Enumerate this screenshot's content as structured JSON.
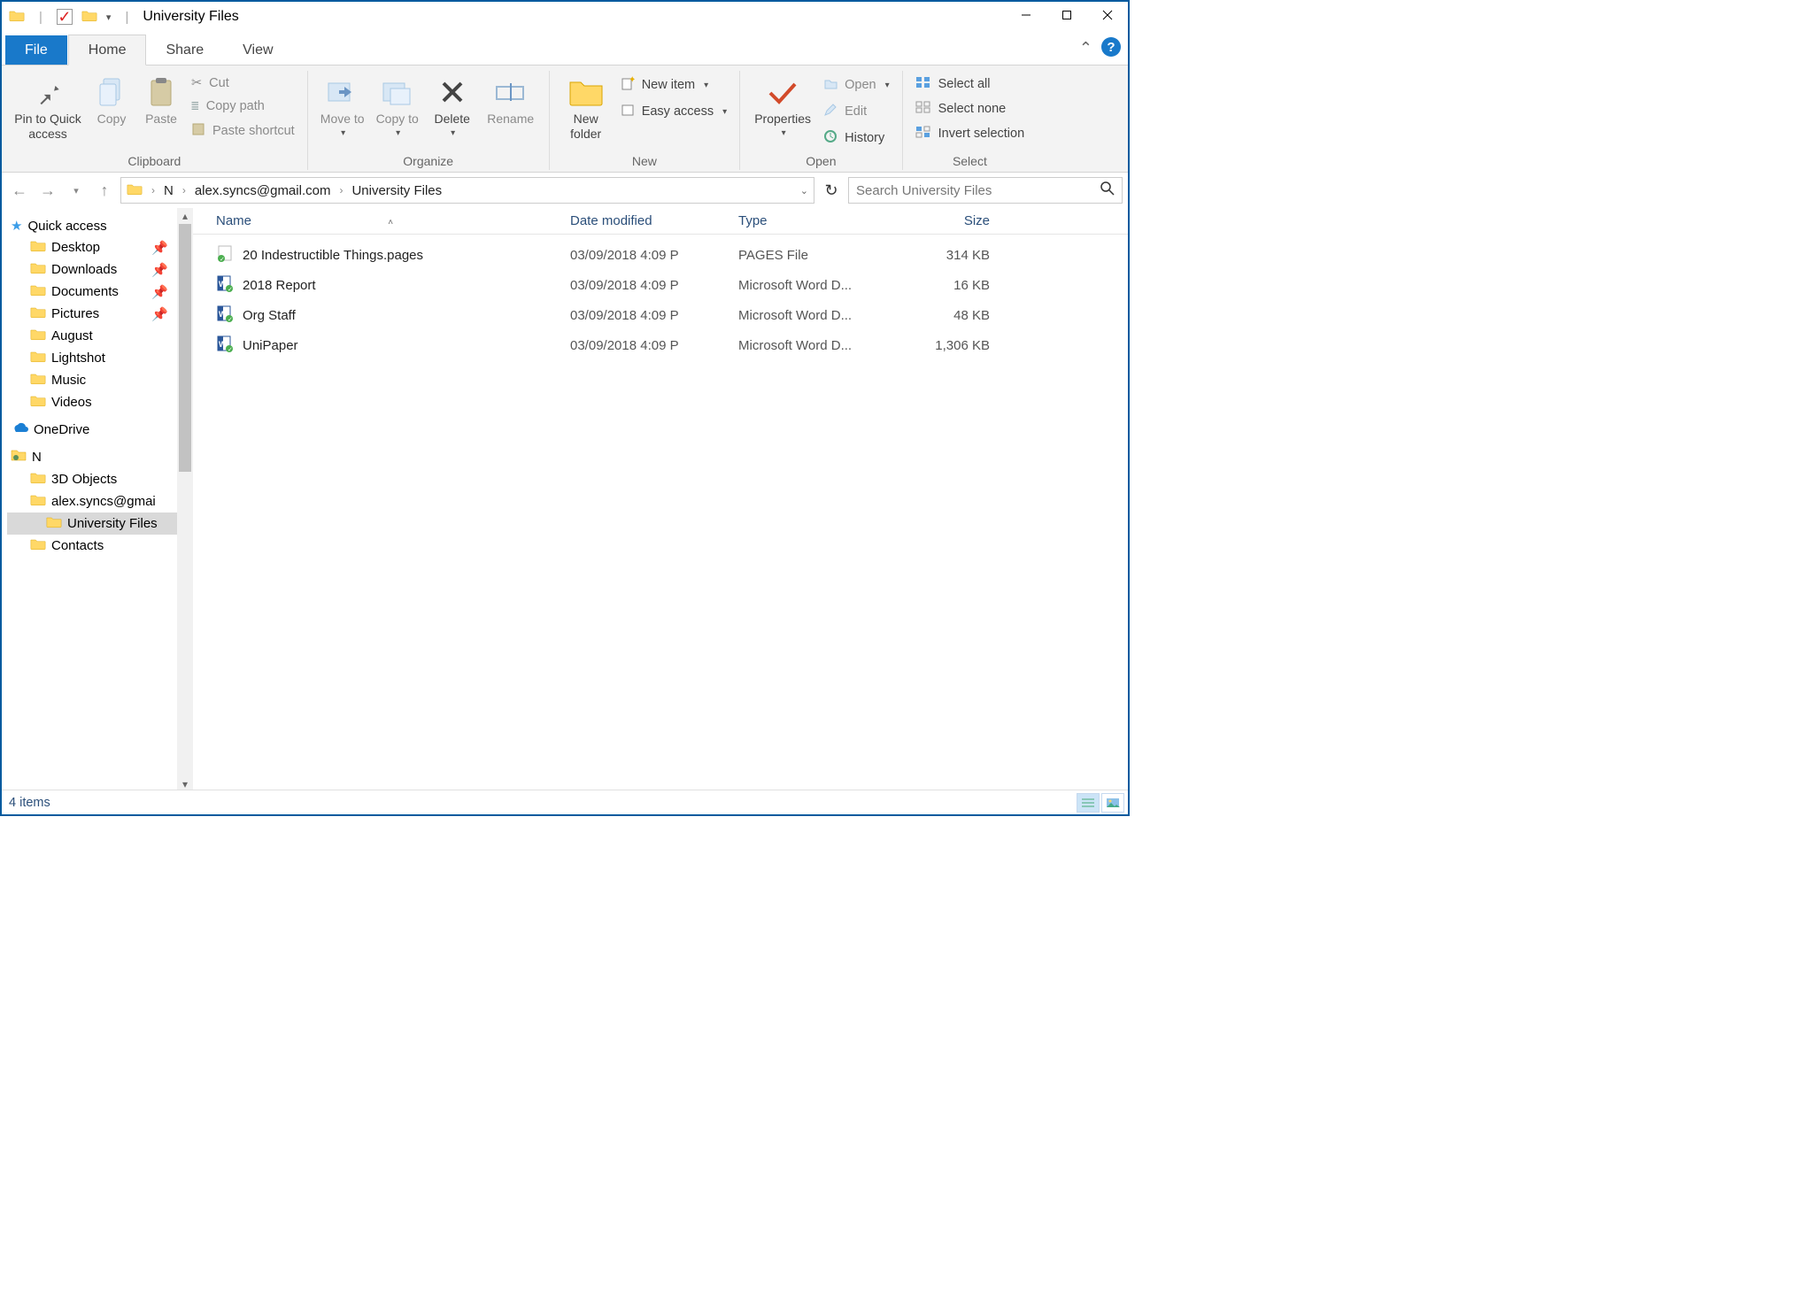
{
  "window": {
    "title": "University Files"
  },
  "tabs": {
    "file": "File",
    "home": "Home",
    "share": "Share",
    "view": "View"
  },
  "ribbon": {
    "clipboard": {
      "label": "Clipboard",
      "pin": "Pin to Quick access",
      "copy": "Copy",
      "paste": "Paste",
      "cut": "Cut",
      "copy_path": "Copy path",
      "paste_shortcut": "Paste shortcut"
    },
    "organize": {
      "label": "Organize",
      "move_to": "Move to",
      "copy_to": "Copy to",
      "delete": "Delete",
      "rename": "Rename"
    },
    "new": {
      "label": "New",
      "new_folder": "New folder",
      "new_item": "New item",
      "easy_access": "Easy access"
    },
    "open": {
      "label": "Open",
      "properties": "Properties",
      "open": "Open",
      "edit": "Edit",
      "history": "History"
    },
    "select": {
      "label": "Select",
      "select_all": "Select all",
      "select_none": "Select none",
      "invert": "Invert selection"
    }
  },
  "address": {
    "crumbs": [
      "N",
      "alex.syncs@gmail.com",
      "University Files"
    ]
  },
  "search": {
    "placeholder": "Search University Files"
  },
  "sidebar": {
    "quick_access": "Quick access",
    "qa_items": [
      "Desktop",
      "Downloads",
      "Documents",
      "Pictures",
      "August",
      "Lightshot",
      "Music",
      "Videos"
    ],
    "onedrive": "OneDrive",
    "n_root": "N",
    "n_items": [
      "3D Objects",
      "alex.syncs@gmai",
      "University Files",
      "Contacts"
    ]
  },
  "columns": {
    "name": "Name",
    "date": "Date modified",
    "type": "Type",
    "size": "Size"
  },
  "files": [
    {
      "name": "20 Indestructible Things.pages",
      "date": "03/09/2018 4:09 P",
      "type": "PAGES File",
      "size": "314 KB",
      "icon": "pages"
    },
    {
      "name": "2018 Report",
      "date": "03/09/2018 4:09 P",
      "type": "Microsoft Word D...",
      "size": "16 KB",
      "icon": "word"
    },
    {
      "name": "Org Staff",
      "date": "03/09/2018 4:09 P",
      "type": "Microsoft Word D...",
      "size": "48 KB",
      "icon": "word"
    },
    {
      "name": "UniPaper",
      "date": "03/09/2018 4:09 P",
      "type": "Microsoft Word D...",
      "size": "1,306 KB",
      "icon": "word"
    }
  ],
  "status": {
    "item_count": "4 items"
  }
}
